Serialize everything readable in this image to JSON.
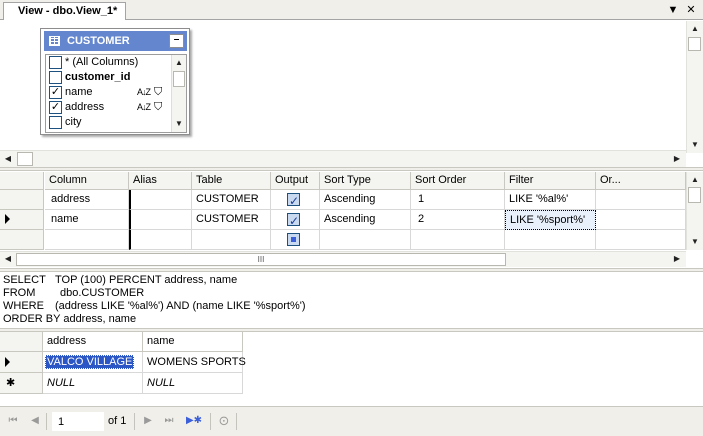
{
  "tab": {
    "title": "View - dbo.View_1*",
    "dropdown_glyph": "▼",
    "close_glyph": "✕"
  },
  "diagram": {
    "table_name": "CUSTOMER",
    "minimize_glyph": "–",
    "columns": [
      {
        "label": "* (All Columns)",
        "checked": false,
        "bold": false
      },
      {
        "label": "customer_id",
        "checked": false,
        "bold": true
      },
      {
        "label": "name",
        "checked": true,
        "bold": false,
        "sorted": true,
        "filtered": true
      },
      {
        "label": "address",
        "checked": true,
        "bold": false,
        "sorted": true,
        "filtered": true
      },
      {
        "label": "city",
        "checked": false,
        "bold": false
      }
    ],
    "sort_glyph": "A↓Z",
    "filter_glyph": "⛉"
  },
  "criteria": {
    "headers": [
      "Column",
      "Alias",
      "Table",
      "Output",
      "Sort Type",
      "Sort Order",
      "Filter",
      "Or..."
    ],
    "rows": [
      {
        "column": "address",
        "alias": "",
        "table": "CUSTOMER",
        "output": true,
        "sort_type": "Ascending",
        "sort_order": "1",
        "filter": "LIKE '%al%'"
      },
      {
        "column": "name",
        "alias": "",
        "table": "CUSTOMER",
        "output": true,
        "sort_type": "Ascending",
        "sort_order": "2",
        "filter": "LIKE '%sport%'"
      }
    ],
    "scroll_grip": "III"
  },
  "sql": {
    "lines": [
      {
        "kw": "SELECT",
        "text": "TOP (100) PERCENT address, name"
      },
      {
        "kw": "FROM",
        "text": "dbo.CUSTOMER"
      },
      {
        "kw": "WHERE",
        "text": "(address LIKE '%al%') AND (name LIKE '%sport%')"
      },
      {
        "kw": "ORDER BY",
        "text": "address, name"
      }
    ]
  },
  "results": {
    "headers": [
      "address",
      "name"
    ],
    "rows": [
      {
        "address": "VALCO VILLAGE",
        "name": "WOMENS SPORTS"
      }
    ],
    "new_row": {
      "address": "NULL",
      "name": "NULL"
    },
    "new_row_marker": "✱"
  },
  "navigator": {
    "current_page": "1",
    "of_label": "of 1",
    "first_glyph": "⏮",
    "prev_glyph": "◀",
    "next_glyph": "▶",
    "last_glyph": "⏭",
    "new_glyph": "▶✱",
    "stop_glyph": "⊙"
  }
}
